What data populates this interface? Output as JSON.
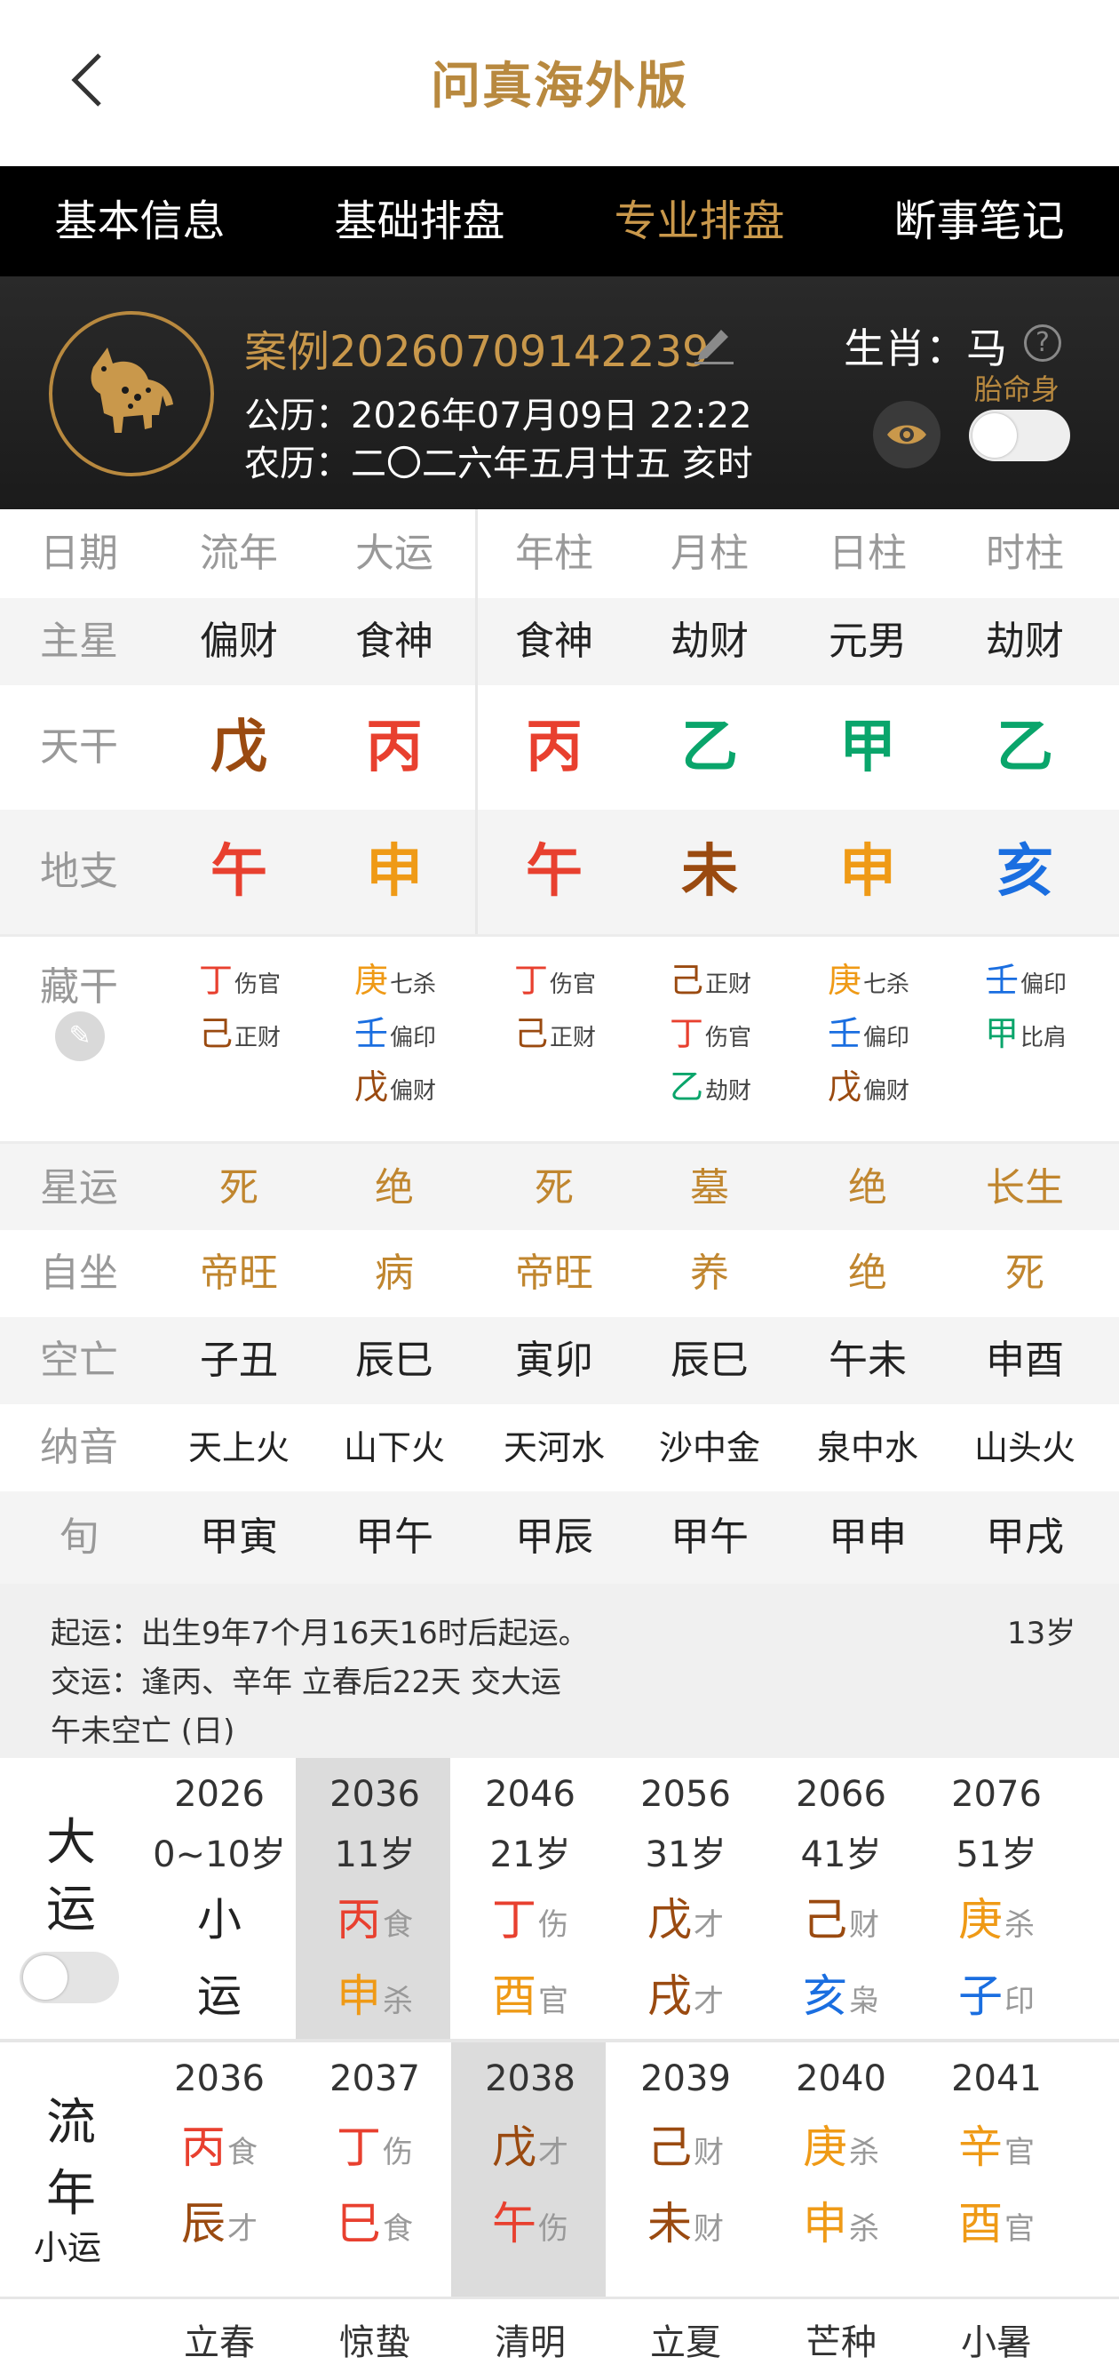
{
  "header": {
    "title": "问真海外版"
  },
  "tabs": [
    "基本信息",
    "基础排盘",
    "专业排盘",
    "断事笔记"
  ],
  "profile": {
    "case": "案例20260709142239",
    "solar_label": "公历：",
    "solar": "2026年07月09日 22:22",
    "lunar_label": "农历：",
    "lunar": "二〇二六年五月廿五 亥时",
    "zodiac_label": "生肖：",
    "zodiac": "马",
    "help": "?",
    "taimingshen": "胎命身"
  },
  "table": {
    "head": [
      "日期",
      "流年",
      "大运",
      "年柱",
      "月柱",
      "日柱",
      "时柱"
    ],
    "zhuxing": [
      "主星",
      "偏财",
      "食神",
      "食神",
      "劫财",
      "元男",
      "劫财"
    ],
    "tiangan_label": "天干",
    "tiangan": [
      "戊",
      "丙",
      "丙",
      "乙",
      "甲",
      "乙"
    ],
    "tiangan_colors": [
      "#9a4a10",
      "#e8402f",
      "#e8402f",
      "#0aa56b",
      "#0aa56b",
      "#0aa56b"
    ],
    "dizhi_label": "地支",
    "dizhi": [
      "午",
      "申",
      "午",
      "未",
      "申",
      "亥"
    ],
    "dizhi_colors": [
      "#e8402f",
      "#ef9a16",
      "#e8402f",
      "#9a4a10",
      "#ef9a16",
      "#1a6ee0"
    ],
    "canggan_label": "藏干",
    "canggan": [
      [
        {
          "g": "丁",
          "s": "伤官",
          "c": "#e8402f"
        },
        {
          "g": "己",
          "s": "正财",
          "c": "#9a4a10"
        }
      ],
      [
        {
          "g": "庚",
          "s": "七杀",
          "c": "#ef9a16"
        },
        {
          "g": "壬",
          "s": "偏印",
          "c": "#1a6ee0"
        },
        {
          "g": "戊",
          "s": "偏财",
          "c": "#9a4a10"
        }
      ],
      [
        {
          "g": "丁",
          "s": "伤官",
          "c": "#e8402f"
        },
        {
          "g": "己",
          "s": "正财",
          "c": "#9a4a10"
        }
      ],
      [
        {
          "g": "己",
          "s": "正财",
          "c": "#9a4a10"
        },
        {
          "g": "丁",
          "s": "伤官",
          "c": "#e8402f"
        },
        {
          "g": "乙",
          "s": "劫财",
          "c": "#0aa56b"
        }
      ],
      [
        {
          "g": "庚",
          "s": "七杀",
          "c": "#ef9a16"
        },
        {
          "g": "壬",
          "s": "偏印",
          "c": "#1a6ee0"
        },
        {
          "g": "戊",
          "s": "偏财",
          "c": "#9a4a10"
        }
      ],
      [
        {
          "g": "壬",
          "s": "偏印",
          "c": "#1a6ee0"
        },
        {
          "g": "甲",
          "s": "比肩",
          "c": "#0aa56b"
        }
      ]
    ],
    "xingyun": [
      "星运",
      "死",
      "绝",
      "死",
      "墓",
      "绝",
      "长生"
    ],
    "zizuo": [
      "自坐",
      "帝旺",
      "病",
      "帝旺",
      "养",
      "绝",
      "死"
    ],
    "kongwang": [
      "空亡",
      "子丑",
      "辰巳",
      "寅卯",
      "辰巳",
      "午未",
      "申酉"
    ],
    "nayin": [
      "纳音",
      "天上火",
      "山下火",
      "天河水",
      "沙中金",
      "泉中水",
      "山头火"
    ],
    "xun": [
      "旬",
      "甲寅",
      "甲午",
      "甲辰",
      "甲午",
      "甲申",
      "甲戌"
    ]
  },
  "info": {
    "qiyun": "起运：出生9年7个月16天16时后起运。",
    "age": "13岁",
    "jiaoyun": "交运：逢丙、辛年 立春后22天 交大运",
    "kong": "午未空亡 (日)"
  },
  "dayun": {
    "label1": "大",
    "label2": "运",
    "cols": [
      {
        "yr": "2026",
        "age": "0~10岁",
        "g": "小",
        "gs": "",
        "gc": "#222",
        "z": "运",
        "zs": "",
        "zc": "#222"
      },
      {
        "yr": "2036",
        "age": "11岁",
        "g": "丙",
        "gs": "食",
        "gc": "#e8402f",
        "z": "申",
        "zs": "杀",
        "zc": "#ef9a16"
      },
      {
        "yr": "2046",
        "age": "21岁",
        "g": "丁",
        "gs": "伤",
        "gc": "#e8402f",
        "z": "酉",
        "zs": "官",
        "zc": "#ef9a16"
      },
      {
        "yr": "2056",
        "age": "31岁",
        "g": "戊",
        "gs": "才",
        "gc": "#9a4a10",
        "z": "戌",
        "zs": "才",
        "zc": "#9a4a10"
      },
      {
        "yr": "2066",
        "age": "41岁",
        "g": "己",
        "gs": "财",
        "gc": "#9a4a10",
        "z": "亥",
        "zs": "枭",
        "zc": "#1a6ee0"
      },
      {
        "yr": "2076",
        "age": "51岁",
        "g": "庚",
        "gs": "杀",
        "gc": "#ef9a16",
        "z": "子",
        "zs": "印",
        "zc": "#1a6ee0"
      }
    ]
  },
  "liunian": {
    "label1": "流",
    "label2": "年",
    "label3": "小运",
    "cols": [
      {
        "yr": "2036",
        "g": "丙",
        "gs": "食",
        "gc": "#e8402f",
        "z": "辰",
        "zs": "才",
        "zc": "#9a4a10"
      },
      {
        "yr": "2037",
        "g": "丁",
        "gs": "伤",
        "gc": "#e8402f",
        "z": "巳",
        "zs": "食",
        "zc": "#e8402f"
      },
      {
        "yr": "2038",
        "g": "戊",
        "gs": "才",
        "gc": "#9a4a10",
        "z": "午",
        "zs": "伤",
        "zc": "#e8402f"
      },
      {
        "yr": "2039",
        "g": "己",
        "gs": "财",
        "gc": "#9a4a10",
        "z": "未",
        "zs": "财",
        "zc": "#9a4a10"
      },
      {
        "yr": "2040",
        "g": "庚",
        "gs": "杀",
        "gc": "#ef9a16",
        "z": "申",
        "zs": "杀",
        "zc": "#ef9a16"
      },
      {
        "yr": "2041",
        "g": "辛",
        "gs": "官",
        "gc": "#ef9a16",
        "z": "酉",
        "zs": "官",
        "zc": "#ef9a16"
      }
    ]
  },
  "jieqi": [
    "立春",
    "惊蛰",
    "清明",
    "立夏",
    "芒种",
    "小暑"
  ],
  "colors": {
    "accent": "#c9984b",
    "highlight": "#dcdcdc"
  }
}
